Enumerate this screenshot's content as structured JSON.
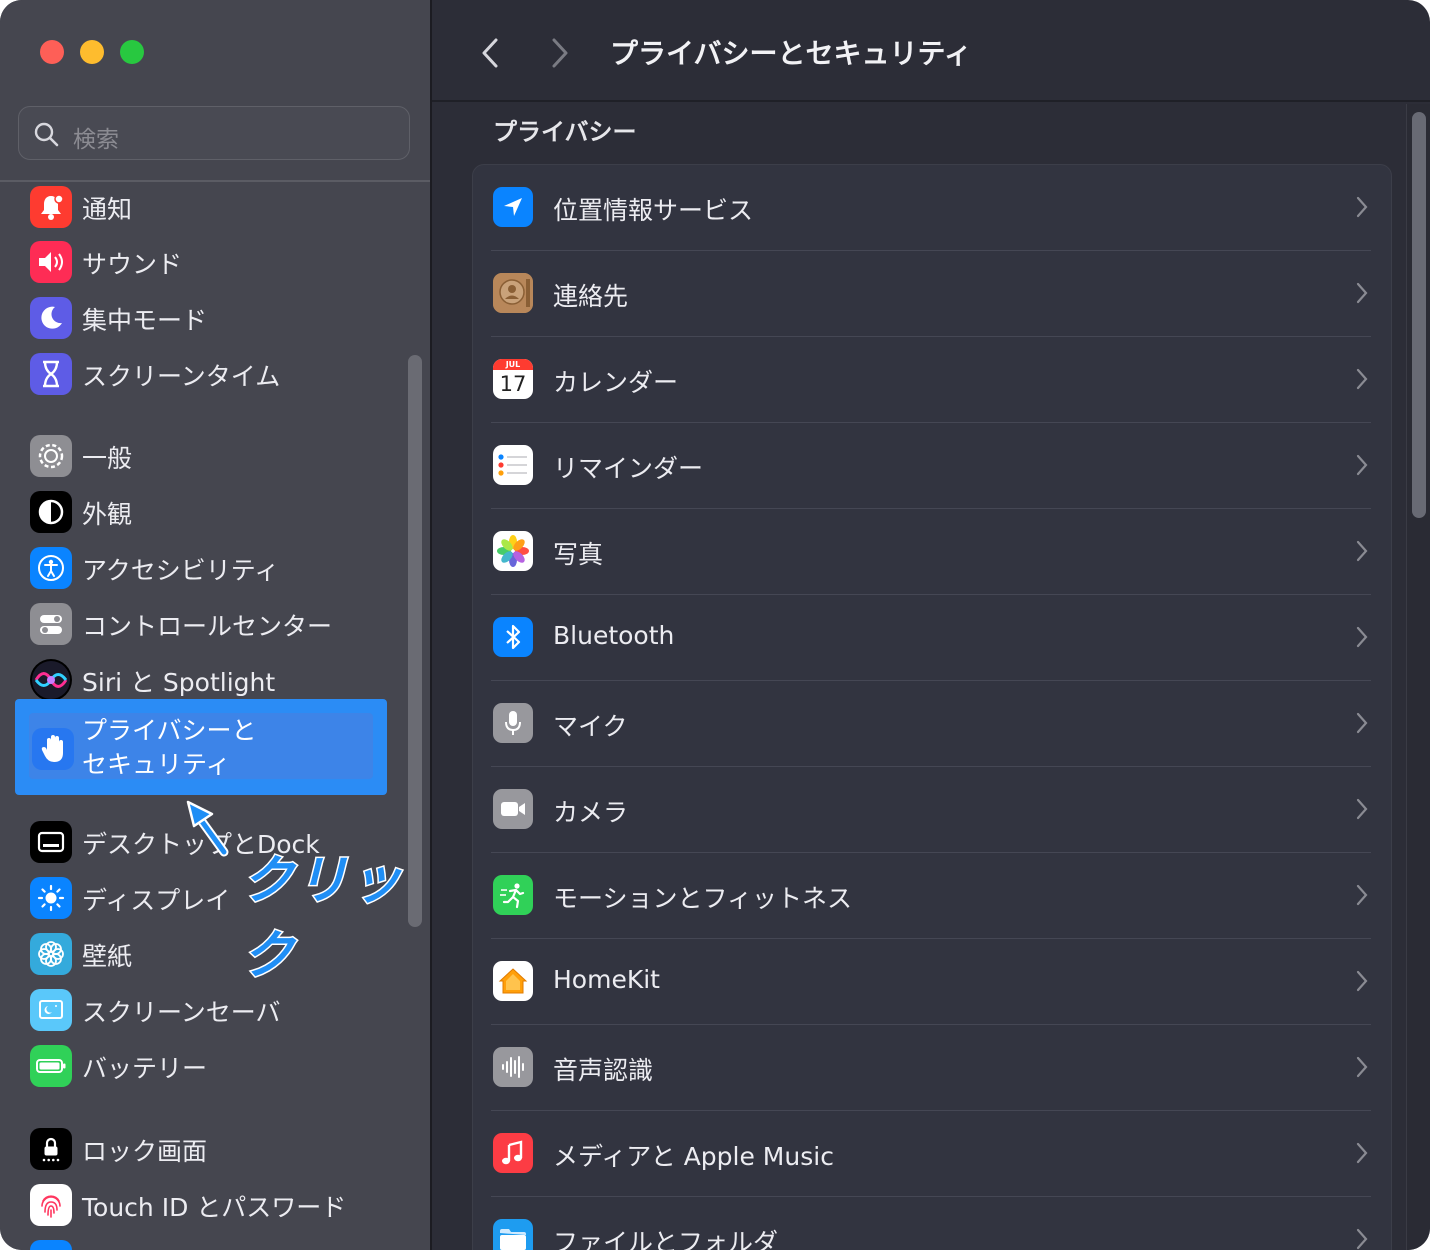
{
  "window": {
    "title": "プライバシーとセキュリティ"
  },
  "sidebar": {
    "search_placeholder": "検索",
    "items": [
      {
        "label": "通知",
        "icon": "bell-icon",
        "color": "#fe3b30"
      },
      {
        "label": "サウンド",
        "icon": "speaker-icon",
        "color": "#fe2c55"
      },
      {
        "label": "集中モード",
        "icon": "moon-icon",
        "color": "#5e5ce6"
      },
      {
        "label": "スクリーンタイム",
        "icon": "hourglass-icon",
        "color": "#5e5ce6"
      },
      {
        "label": "一般",
        "icon": "gear-icon",
        "color": "#8e8e93"
      },
      {
        "label": "外観",
        "icon": "appearance-icon",
        "color": "#000000"
      },
      {
        "label": "アクセシビリティ",
        "icon": "accessibility-icon",
        "color": "#0a84ff"
      },
      {
        "label": "コントロールセンター",
        "icon": "toggles-icon",
        "color": "#8e8e93"
      },
      {
        "label": "Siri と Spotlight",
        "icon": "siri-icon",
        "color": "#000000"
      },
      {
        "label": "デスクトップとDock",
        "icon": "dock-icon",
        "color": "#000000"
      },
      {
        "label": "ディスプレイ",
        "icon": "sun-icon",
        "color": "#0a84ff"
      },
      {
        "label": "壁紙",
        "icon": "flower-icon",
        "color": "#34aadc"
      },
      {
        "label": "スクリーンセーバ",
        "icon": "screensaver-icon",
        "color": "#5ac8fa"
      },
      {
        "label": "バッテリー",
        "icon": "battery-icon",
        "color": "#30d158"
      },
      {
        "label": "ロック画面",
        "icon": "lock-icon",
        "color": "#000000"
      },
      {
        "label": "Touch ID とパスワード",
        "icon": "fingerprint-icon",
        "color": "#ffffff"
      }
    ],
    "selected": {
      "line1": "プライバシーと",
      "line2": "セキュリティ",
      "icon": "hand-icon",
      "color": "#2777f0"
    }
  },
  "annotation": {
    "click_label": "クリック"
  },
  "main": {
    "section_title": "プライバシー",
    "rows": [
      {
        "label": "位置情報サービス",
        "icon": "location-arrow-icon",
        "color": "#0a84ff"
      },
      {
        "label": "連絡先",
        "icon": "contacts-icon",
        "color": "#a67b4a"
      },
      {
        "label": "カレンダー",
        "icon": "calendar-icon",
        "color": "#ffffff",
        "month": "JUL",
        "day": "17"
      },
      {
        "label": "リマインダー",
        "icon": "reminders-icon",
        "color": "#ffffff"
      },
      {
        "label": "写真",
        "icon": "photos-icon",
        "color": "#ffffff"
      },
      {
        "label": "Bluetooth",
        "icon": "bluetooth-icon",
        "color": "#0a84ff"
      },
      {
        "label": "マイク",
        "icon": "microphone-icon",
        "color": "#98989d"
      },
      {
        "label": "カメラ",
        "icon": "camera-icon",
        "color": "#98989d"
      },
      {
        "label": "モーションとフィットネス",
        "icon": "motion-icon",
        "color": "#30d158"
      },
      {
        "label": "HomeKit",
        "icon": "home-icon",
        "color": "#ffffff"
      },
      {
        "label": "音声認識",
        "icon": "waveform-icon",
        "color": "#98989d"
      },
      {
        "label": "メディアと Apple Music",
        "icon": "music-note-icon",
        "color": "#fc3c44"
      },
      {
        "label": "ファイルとフォルダ",
        "icon": "folder-icon",
        "color": "#1e9cf0"
      }
    ]
  }
}
